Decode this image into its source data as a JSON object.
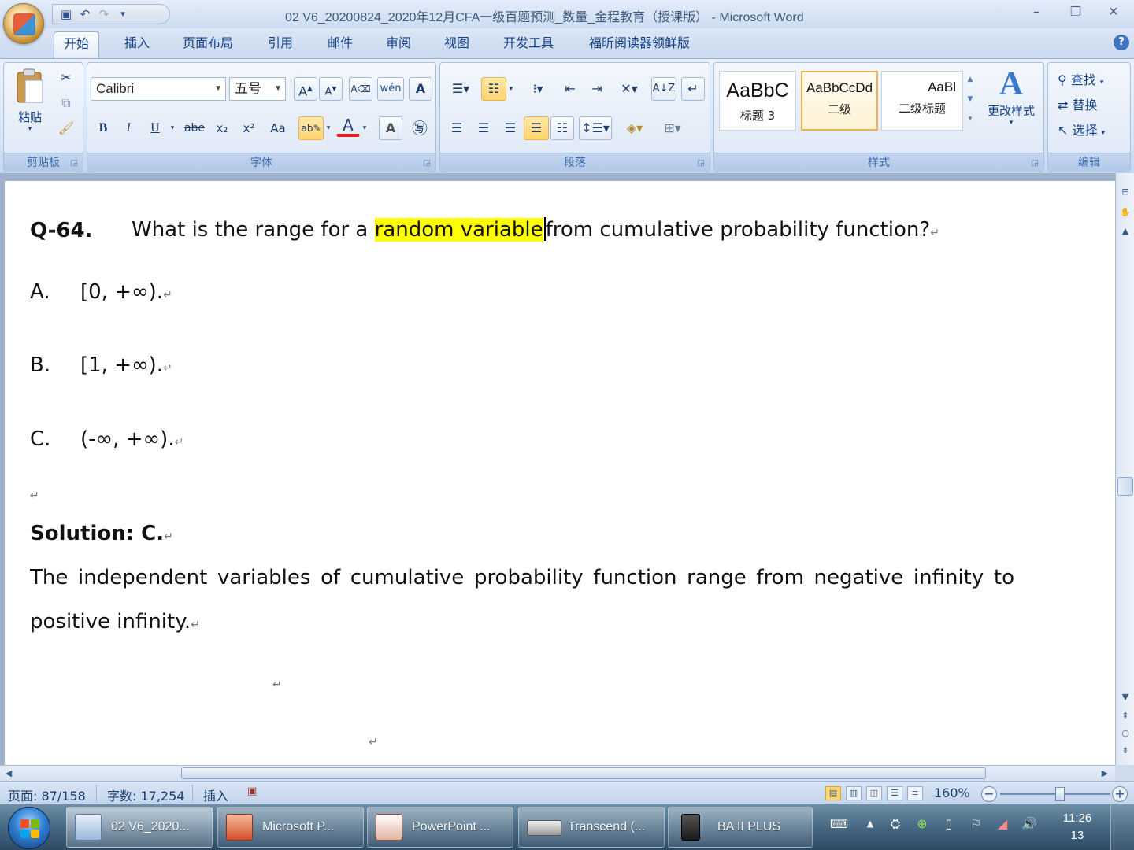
{
  "window": {
    "title": "02 V6_20200824_2020年12月CFA一级百题预测_数量_金程教育（授课版） - Microsoft Word"
  },
  "quick_access": {
    "icons": [
      "save-icon",
      "undo-icon",
      "redo-icon",
      "customize-icon"
    ]
  },
  "tabs": [
    "开始",
    "插入",
    "页面布局",
    "引用",
    "邮件",
    "审阅",
    "视图",
    "开发工具",
    "福昕阅读器领鲜版"
  ],
  "ribbon": {
    "clipboard": {
      "label": "剪贴板",
      "paste": "粘贴"
    },
    "font": {
      "label": "字体",
      "font_name": "Calibri",
      "font_size": "五号",
      "buttons": [
        "B",
        "I",
        "U",
        "abe",
        "x₂",
        "x²",
        "Aa"
      ]
    },
    "paragraph": {
      "label": "段落"
    },
    "styles": {
      "label": "样式",
      "gallery": [
        {
          "sample": "AaBbC",
          "name": "标题 3"
        },
        {
          "sample": "AaBbCcDd",
          "name": "二级"
        },
        {
          "sample": "AaBl",
          "name": "二级标题"
        }
      ],
      "change_styles": "更改样式"
    },
    "editing": {
      "label": "编辑",
      "find": "查找",
      "replace": "替换",
      "select": "选择"
    }
  },
  "document": {
    "question": {
      "number": "Q-64.",
      "text_before": "What is the range for a ",
      "highlight": "random variable",
      "text_after": "from cumulative probability function?"
    },
    "options": [
      {
        "letter": "A.",
        "text": "[0, +∞)."
      },
      {
        "letter": "B.",
        "text": "[1, +∞)."
      },
      {
        "letter": "C.",
        "text": "(-∞, +∞)."
      }
    ],
    "solution_label": "Solution: C.",
    "solution_line1": "The independent variables of cumulative probability function range from negative infinity to",
    "solution_line2": "positive infinity.",
    "paragraph_mark": "↵"
  },
  "statusbar": {
    "page": "页面: 87/158",
    "words": "字数: 17,254",
    "mode": "插入",
    "zoom": "160%"
  },
  "taskbar": {
    "items": [
      "02 V6_2020...",
      "Microsoft P...",
      "PowerPoint ...",
      "Transcend (...",
      "BA II PLUS"
    ],
    "time": "11:26",
    "date": "13"
  },
  "colors": {
    "highlight": "#ffff00",
    "ribbon_text": "#15428b"
  }
}
